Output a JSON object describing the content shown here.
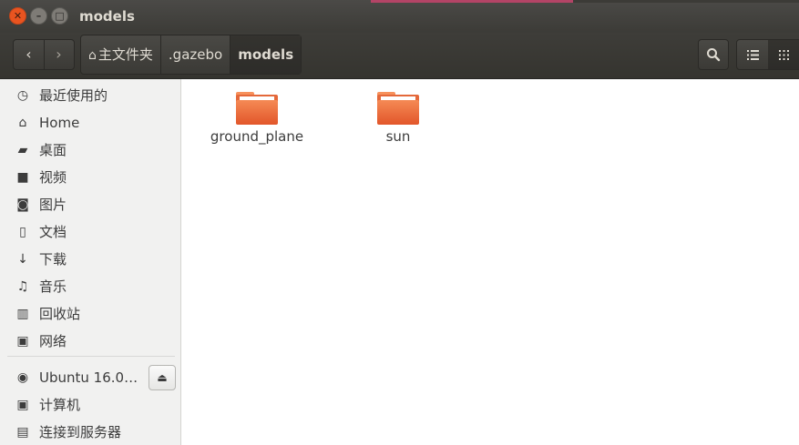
{
  "window": {
    "title": "models"
  },
  "toolbar": {
    "back_icon": "chevron-left-icon",
    "forward_icon": "chevron-right-icon",
    "breadcrumbs": [
      "主文件夹",
      ".gazebo",
      "models"
    ],
    "search_icon": "search-icon",
    "list_view_icon": "list-view-icon",
    "grid_view_icon": "grid-view-icon"
  },
  "sidebar": {
    "items": [
      {
        "label": "最近使用的",
        "icon": "clock-icon"
      },
      {
        "label": "Home",
        "icon": "home-icon"
      },
      {
        "label": "桌面",
        "icon": "folder-icon"
      },
      {
        "label": "视频",
        "icon": "video-icon"
      },
      {
        "label": "图片",
        "icon": "camera-icon"
      },
      {
        "label": "文档",
        "icon": "document-icon"
      },
      {
        "label": "下载",
        "icon": "download-icon"
      },
      {
        "label": "音乐",
        "icon": "music-icon"
      },
      {
        "label": "回收站",
        "icon": "trash-icon"
      },
      {
        "label": "网络",
        "icon": "network-icon"
      }
    ],
    "devices": [
      {
        "label": "Ubuntu 16.0…",
        "icon": "disc-icon"
      },
      {
        "label": "计算机",
        "icon": "computer-icon"
      },
      {
        "label": "连接到服务器",
        "icon": "server-icon"
      }
    ]
  },
  "files": [
    {
      "name": "ground_plane",
      "icon": "folder-icon"
    },
    {
      "name": "sun",
      "icon": "folder-icon"
    }
  ],
  "colors": {
    "accent": "#e95420",
    "folder": "#e4683a"
  }
}
